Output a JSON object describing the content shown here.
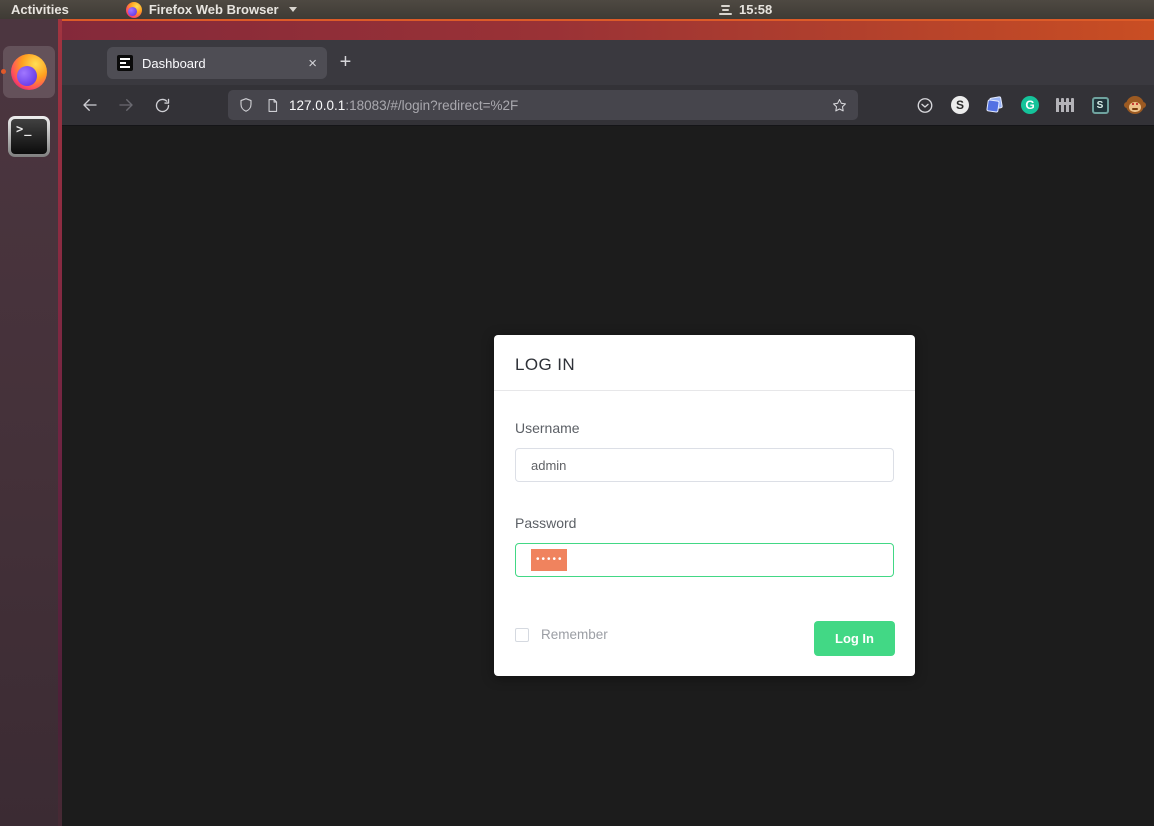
{
  "desktop": {
    "activities_label": "Activities",
    "app_menu_label": "Firefox Web Browser",
    "clock_time": "15:58",
    "terminal_glyph": ">_"
  },
  "browser": {
    "tab_title": "Dashboard",
    "close_tab_glyph": "×",
    "new_tab_glyph": "+",
    "url_host": "127.0.0.1",
    "url_rest": ":18083/#/login?redirect=%2F",
    "extension_letters": {
      "s_badge": "S",
      "grammarly": "G",
      "stylus": "S"
    },
    "extension_icons": [
      "pocket-icon",
      "s-badge-icon",
      "blue-notes-icon",
      "grammarly-icon",
      "fence-icon",
      "stylus-icon",
      "monkey-icon"
    ]
  },
  "login": {
    "title": "LOG IN",
    "username_label": "Username",
    "username_value": "admin",
    "password_label": "Password",
    "password_dots": "•••••",
    "remember_label": "Remember",
    "submit_label": "Log In"
  },
  "colors": {
    "accent_green": "#42d885",
    "selection_orange": "#f0835e",
    "ubuntu_orange": "#e0592a",
    "page_background": "#1c1c1c"
  }
}
